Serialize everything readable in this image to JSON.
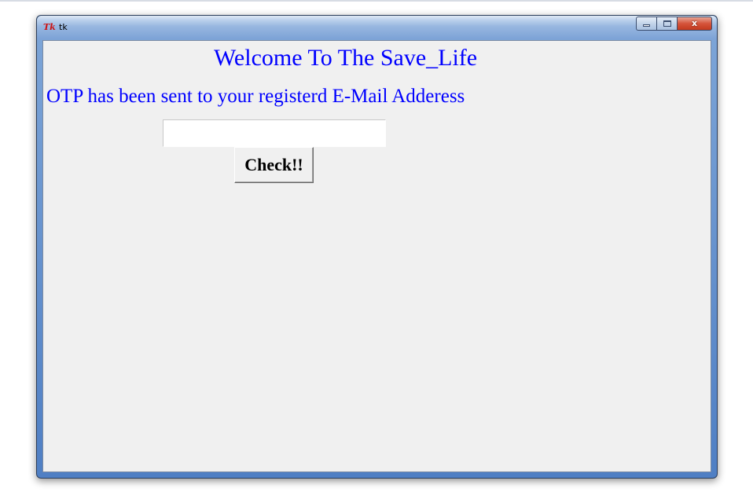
{
  "window": {
    "title": "tk",
    "icon": "tk-feather-icon",
    "icon_text": "Tk",
    "close_glyph": "x"
  },
  "main": {
    "heading": "Welcome To The Save_Life",
    "otp_message": "OTP has been sent to your registerd E-Mail Adderess",
    "otp_input_value": "",
    "check_button_label": "Check!!"
  },
  "colors": {
    "text_accent": "#0000ff",
    "client_background": "#f0f0f0",
    "titlebar": "#7ca2d6",
    "close_button": "#c2391e"
  }
}
